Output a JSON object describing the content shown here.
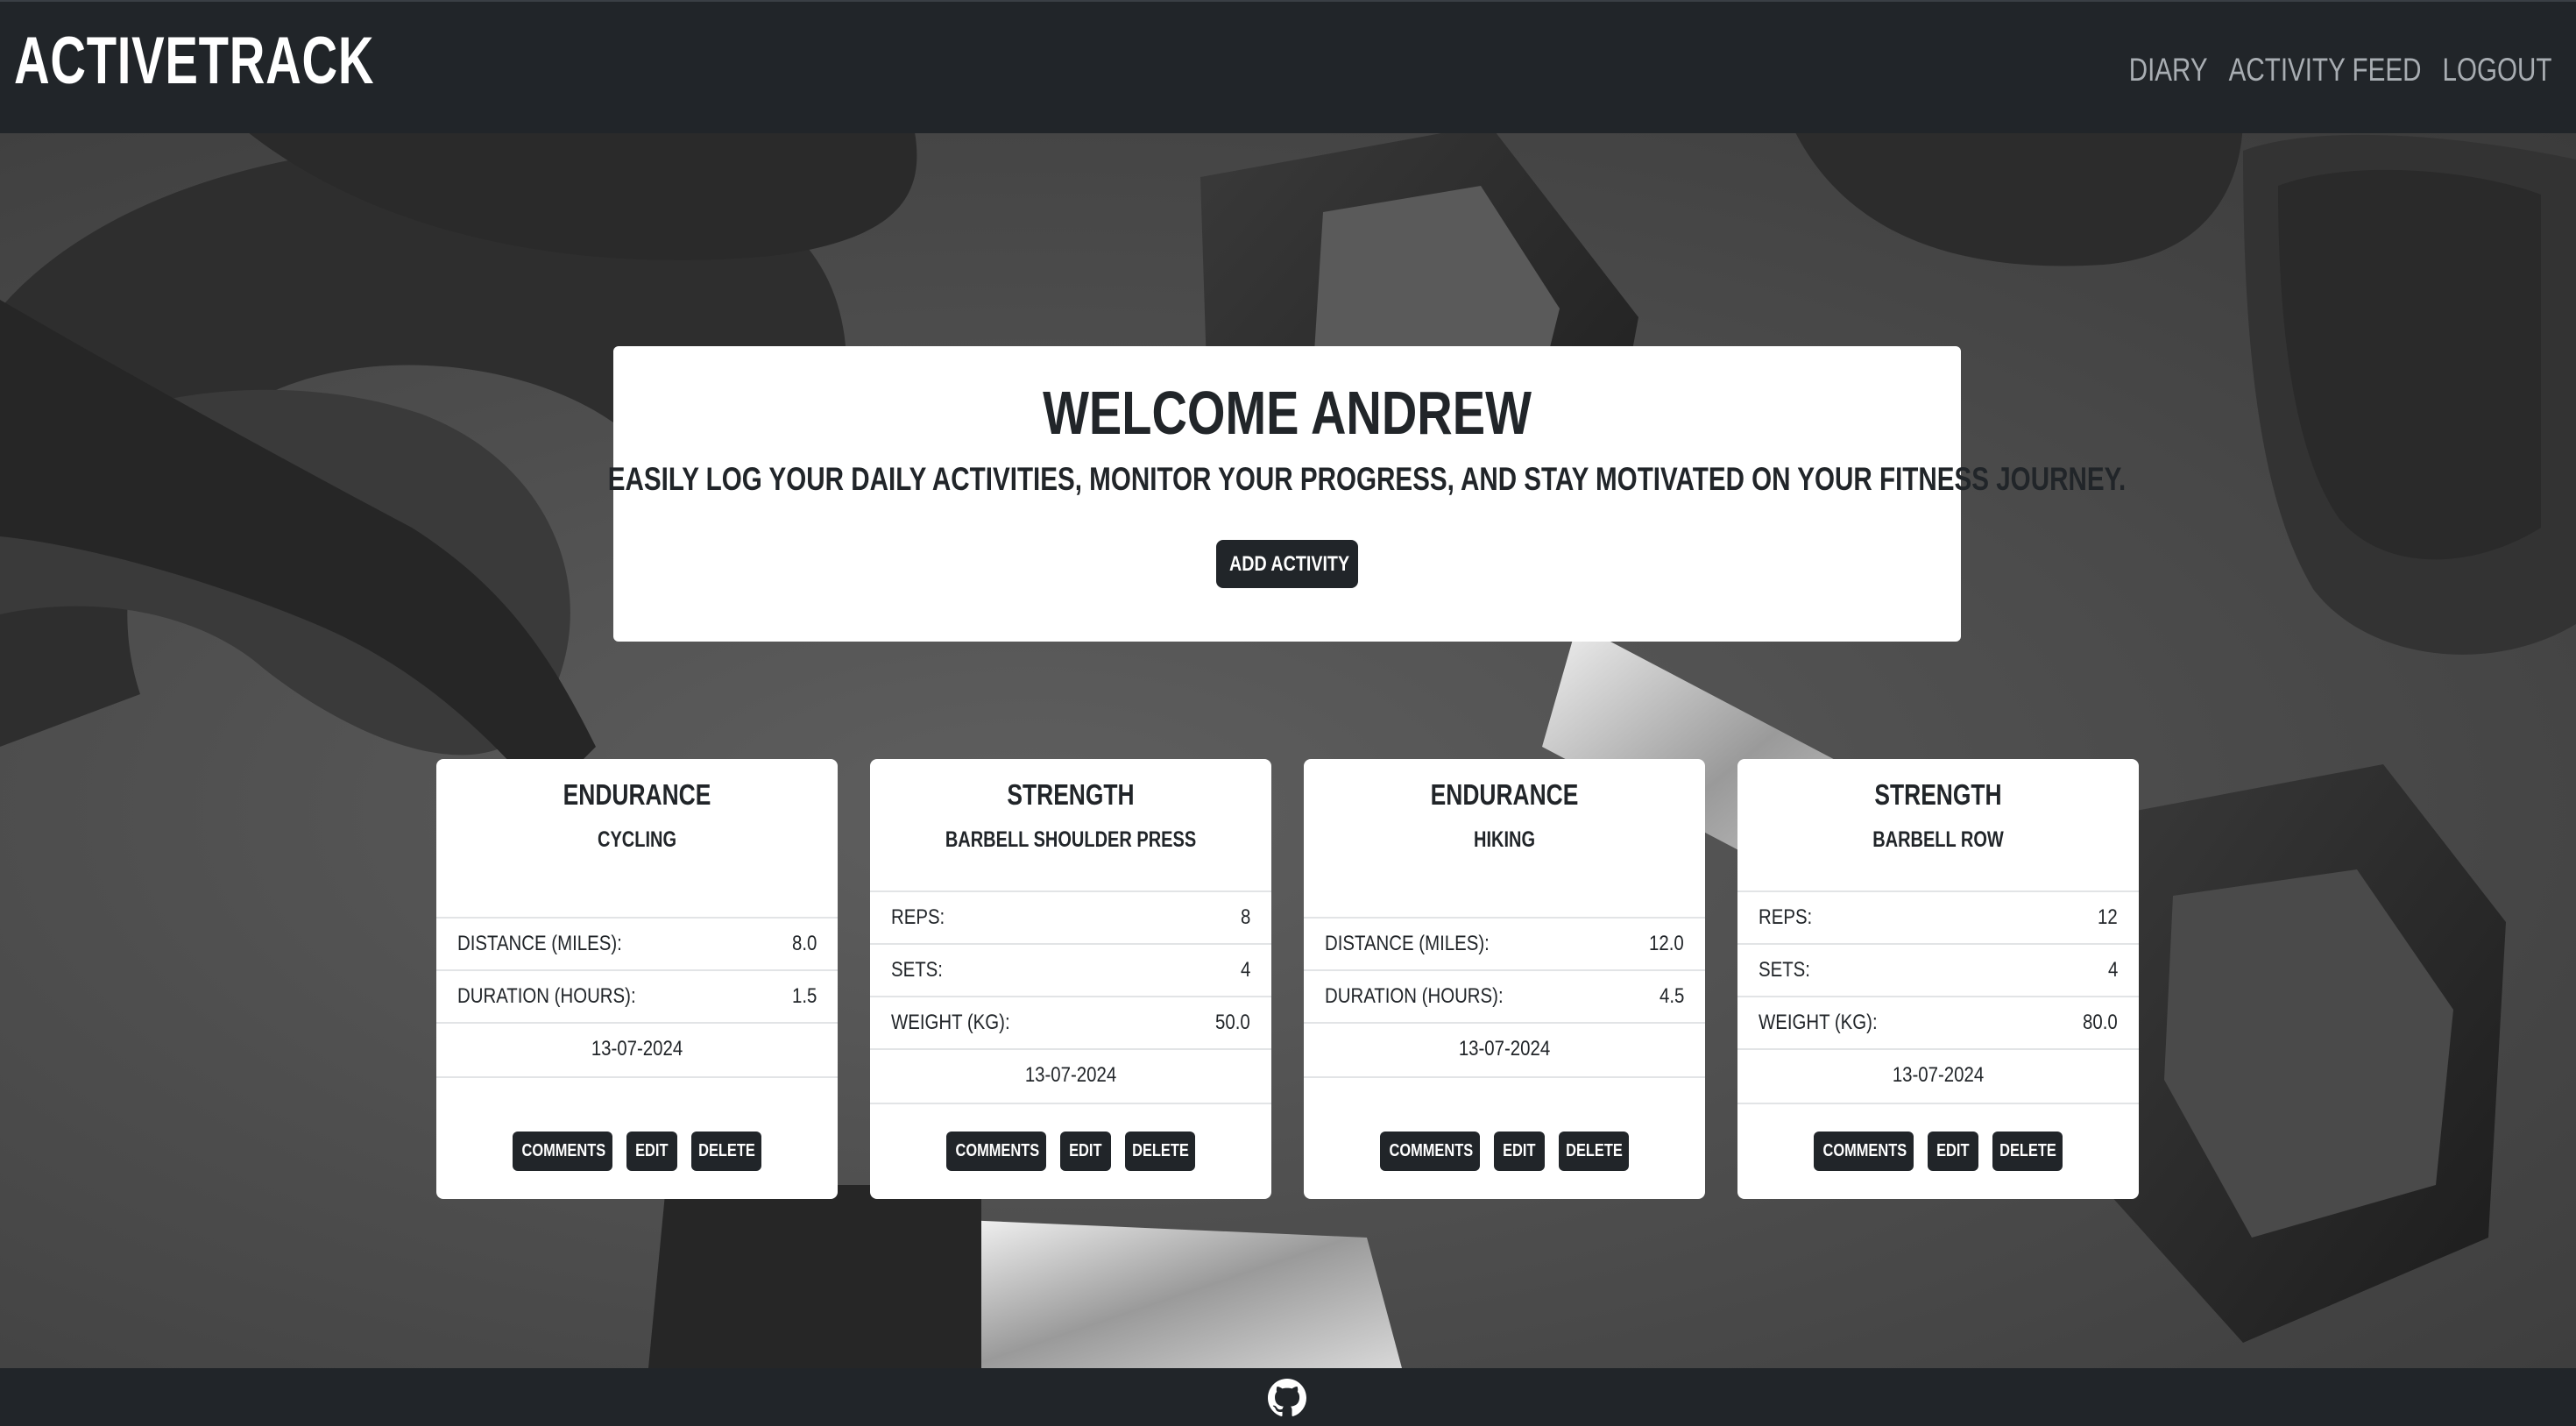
{
  "navbar": {
    "brand": "ACTIVETRACK",
    "links": [
      "DIARY",
      "ACTIVITY FEED",
      "LOGOUT"
    ]
  },
  "welcome": {
    "title": "WELCOME ANDREW",
    "subtitle": "EASILY LOG YOUR DAILY ACTIVITIES, MONITOR YOUR PROGRESS, AND STAY MOTIVATED ON YOUR FITNESS JOURNEY.",
    "add_button": "ADD ACTIVITY"
  },
  "cards": [
    {
      "type": "ENDURANCE",
      "activity": "CYCLING",
      "stats": [
        {
          "label": "DISTANCE (MILES):",
          "value": "8.0"
        },
        {
          "label": "DURATION (HOURS):",
          "value": "1.5"
        }
      ],
      "date": "13-07-2024"
    },
    {
      "type": "STRENGTH",
      "activity": "BARBELL SHOULDER PRESS",
      "stats": [
        {
          "label": "REPS:",
          "value": "8"
        },
        {
          "label": "SETS:",
          "value": "4"
        },
        {
          "label": "WEIGHT (KG):",
          "value": "50.0"
        }
      ],
      "date": "13-07-2024"
    },
    {
      "type": "ENDURANCE",
      "activity": "HIKING",
      "stats": [
        {
          "label": "DISTANCE (MILES):",
          "value": "12.0"
        },
        {
          "label": "DURATION (HOURS):",
          "value": "4.5"
        }
      ],
      "date": "13-07-2024"
    },
    {
      "type": "STRENGTH",
      "activity": "BARBELL ROW",
      "stats": [
        {
          "label": "REPS:",
          "value": "12"
        },
        {
          "label": "SETS:",
          "value": "4"
        },
        {
          "label": "WEIGHT (KG):",
          "value": "80.0"
        }
      ],
      "date": "13-07-2024"
    }
  ],
  "card_buttons": {
    "comments": "COMMENTS",
    "edit": "EDIT",
    "delete": "DELETE"
  },
  "footer": {
    "icon": "github-icon"
  },
  "colors": {
    "nav_bg": "#212529",
    "button_bg": "#212529",
    "nav_link": "#a8adb2",
    "card_bg": "#ffffff"
  }
}
